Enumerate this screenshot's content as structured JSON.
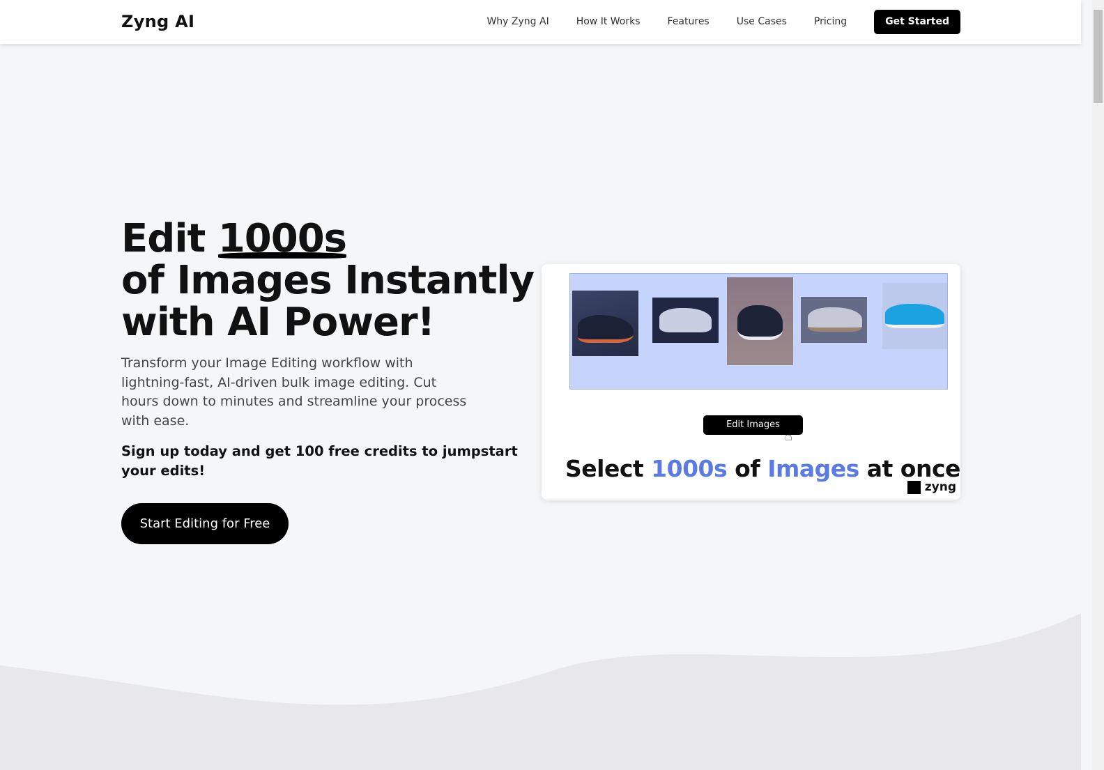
{
  "nav": {
    "logo": "Zyng AI",
    "links": [
      "Why Zyng AI",
      "How It Works",
      "Features",
      "Use Cases",
      "Pricing"
    ],
    "cta": "Get Started"
  },
  "hero": {
    "title_a": "Edit ",
    "title_highlight": "1000s",
    "title_b": "of Images Instantly with AI Power!",
    "description": "Transform your Image Editing workflow with lightning-fast, AI-driven bulk image editing. Cut hours down to minutes and streamline your process with ease.",
    "promo": "Sign up today and get 100 free credits to jumpstart your edits!",
    "button": "Start Editing for Free"
  },
  "demo": {
    "button": "Edit Images",
    "tag_1": "Select ",
    "tag_2": "1000s",
    "tag_3": " of ",
    "tag_4": "Images",
    "tag_5": " at once",
    "brand": "zyng",
    "accent": "#5b7be0",
    "selection_color": "#c6d3fb"
  }
}
